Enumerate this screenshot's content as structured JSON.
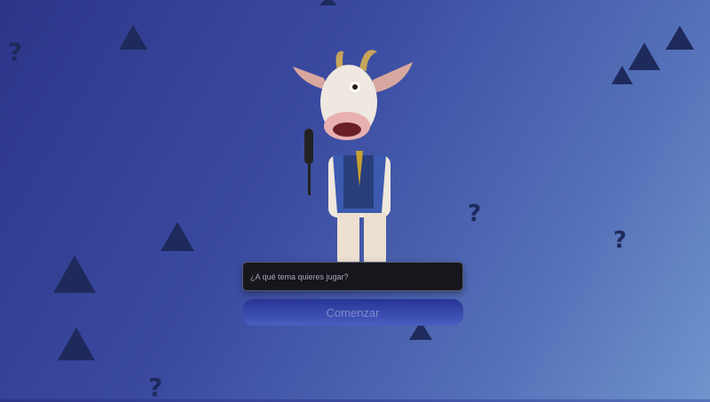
{
  "input": {
    "placeholder": "¿A qué tema quieres jugar?",
    "value": ""
  },
  "start_button": {
    "label": "Comenzar"
  },
  "decor": {
    "question_mark": "?",
    "shape_color": "#1e2a5c"
  },
  "mascot": {
    "description_icon": "goat-mascot-with-microphone"
  }
}
